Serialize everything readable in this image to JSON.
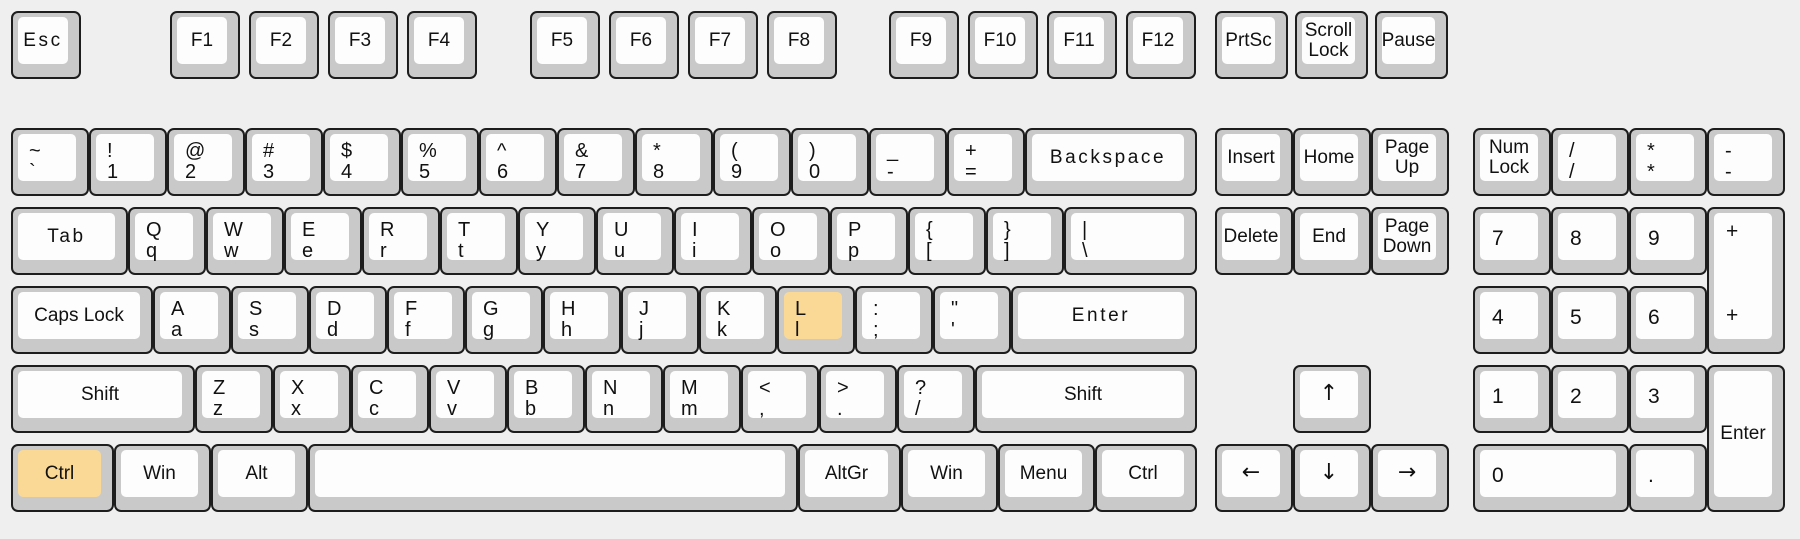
{
  "meta": {
    "title": "Keyboard Layout Diagram",
    "highlight_color": "#f9d995",
    "key_face_color": "#fdfdfd",
    "key_body_color": "#c9c9c9",
    "background_color": "#efefef",
    "highlighted_keys": [
      "L",
      "Ctrl"
    ]
  },
  "function_row": {
    "esc": {
      "label": "Esc"
    },
    "group1": [
      {
        "label": "F1"
      },
      {
        "label": "F2"
      },
      {
        "label": "F3"
      },
      {
        "label": "F4"
      }
    ],
    "group2": [
      {
        "label": "F5"
      },
      {
        "label": "F6"
      },
      {
        "label": "F7"
      },
      {
        "label": "F8"
      }
    ],
    "group3": [
      {
        "label": "F9"
      },
      {
        "label": "F10"
      },
      {
        "label": "F11"
      },
      {
        "label": "F12"
      }
    ],
    "sys": [
      {
        "label": "PrtSc"
      },
      {
        "line1": "Scroll",
        "line2": "Lock"
      },
      {
        "label": "Pause"
      }
    ]
  },
  "number_row": [
    {
      "shift": "~",
      "base": "`"
    },
    {
      "shift": "!",
      "base": "1"
    },
    {
      "shift": "@",
      "base": "2"
    },
    {
      "shift": "#",
      "base": "3"
    },
    {
      "shift": "$",
      "base": "4"
    },
    {
      "shift": "%",
      "base": "5"
    },
    {
      "shift": "^",
      "base": "6"
    },
    {
      "shift": "&",
      "base": "7"
    },
    {
      "shift": "*",
      "base": "8"
    },
    {
      "shift": "(",
      "base": "9"
    },
    {
      "shift": ")",
      "base": "0"
    },
    {
      "shift": "_",
      "base": "-"
    },
    {
      "shift": "+",
      "base": "="
    },
    {
      "label": "Backspace"
    }
  ],
  "tab_row": [
    {
      "label": "Tab"
    },
    {
      "shift": "Q",
      "base": "q"
    },
    {
      "shift": "W",
      "base": "w"
    },
    {
      "shift": "E",
      "base": "e"
    },
    {
      "shift": "R",
      "base": "r"
    },
    {
      "shift": "T",
      "base": "t"
    },
    {
      "shift": "Y",
      "base": "y"
    },
    {
      "shift": "U",
      "base": "u"
    },
    {
      "shift": "I",
      "base": "i"
    },
    {
      "shift": "O",
      "base": "o"
    },
    {
      "shift": "P",
      "base": "p"
    },
    {
      "shift": "{",
      "base": "["
    },
    {
      "shift": "}",
      "base": "]"
    },
    {
      "shift": "|",
      "base": "\\"
    }
  ],
  "caps_row": [
    {
      "label": "Caps Lock"
    },
    {
      "shift": "A",
      "base": "a"
    },
    {
      "shift": "S",
      "base": "s"
    },
    {
      "shift": "D",
      "base": "d"
    },
    {
      "shift": "F",
      "base": "f"
    },
    {
      "shift": "G",
      "base": "g"
    },
    {
      "shift": "H",
      "base": "h"
    },
    {
      "shift": "J",
      "base": "j"
    },
    {
      "shift": "K",
      "base": "k"
    },
    {
      "shift": "L",
      "base": "l",
      "highlighted": true
    },
    {
      "shift": ":",
      "base": ";"
    },
    {
      "shift": "\"",
      "base": "'"
    },
    {
      "label": "Enter"
    }
  ],
  "shift_row": [
    {
      "label": "Shift"
    },
    {
      "shift": "Z",
      "base": "z"
    },
    {
      "shift": "X",
      "base": "x"
    },
    {
      "shift": "C",
      "base": "c"
    },
    {
      "shift": "V",
      "base": "v"
    },
    {
      "shift": "B",
      "base": "b"
    },
    {
      "shift": "N",
      "base": "n"
    },
    {
      "shift": "M",
      "base": "m"
    },
    {
      "shift": "<",
      "base": ","
    },
    {
      "shift": ">",
      "base": "."
    },
    {
      "shift": "?",
      "base": "/"
    },
    {
      "label": "Shift"
    }
  ],
  "bottom_row": [
    {
      "label": "Ctrl",
      "highlighted": true
    },
    {
      "label": "Win"
    },
    {
      "label": "Alt"
    },
    {
      "label": ""
    },
    {
      "label": "AltGr"
    },
    {
      "label": "Win"
    },
    {
      "label": "Menu"
    },
    {
      "label": "Ctrl"
    }
  ],
  "nav_cluster": [
    {
      "label": "Insert"
    },
    {
      "label": "Home"
    },
    {
      "line1": "Page",
      "line2": "Up"
    },
    {
      "label": "Delete"
    },
    {
      "label": "End"
    },
    {
      "line1": "Page",
      "line2": "Down"
    }
  ],
  "arrow_cluster": {
    "up": {
      "glyph": "↑",
      "name": "arrow-up"
    },
    "left": {
      "glyph": "←",
      "name": "arrow-left"
    },
    "down": {
      "glyph": "↓",
      "name": "arrow-down"
    },
    "right": {
      "glyph": "→",
      "name": "arrow-right"
    }
  },
  "numpad": {
    "row1": [
      {
        "line1": "Num",
        "line2": "Lock"
      },
      {
        "shift": "/",
        "base": "/"
      },
      {
        "shift": "*",
        "base": "*"
      },
      {
        "shift": "-",
        "base": "-"
      }
    ],
    "row2": [
      {
        "label": "7"
      },
      {
        "label": "8"
      },
      {
        "label": "9"
      }
    ],
    "row3": [
      {
        "label": "4"
      },
      {
        "label": "5"
      },
      {
        "label": "6"
      }
    ],
    "row4": [
      {
        "label": "1"
      },
      {
        "label": "2"
      },
      {
        "label": "3"
      }
    ],
    "row5": [
      {
        "label": "0"
      },
      {
        "label": "."
      }
    ],
    "plus": {
      "top": "+",
      "bottom": "+"
    },
    "enter": {
      "label": "Enter"
    }
  }
}
